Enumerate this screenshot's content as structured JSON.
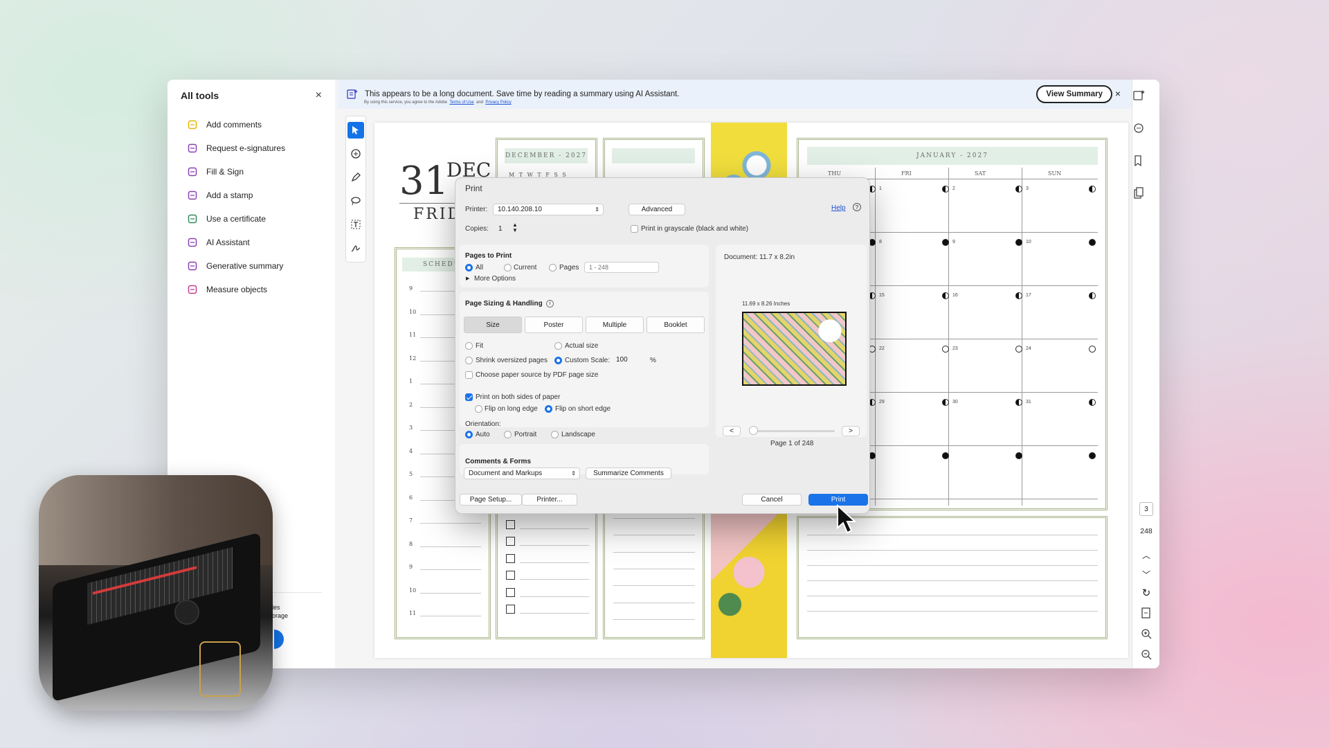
{
  "tools_panel": {
    "title": "All tools",
    "close": "×",
    "items": [
      {
        "label": "Add comments",
        "icon": "comment-icon",
        "color": "#e8b400"
      },
      {
        "label": "Request e-signatures",
        "icon": "esign-icon",
        "color": "#8a3fb0"
      },
      {
        "label": "Fill & Sign",
        "icon": "pen-icon",
        "color": "#8a3fb0"
      },
      {
        "label": "Add a stamp",
        "icon": "stamp-icon",
        "color": "#8a3fb0"
      },
      {
        "label": "Use a certificate",
        "icon": "certificate-icon",
        "color": "#2e8b57"
      },
      {
        "label": "AI Assistant",
        "icon": "ai-assistant-icon",
        "color": "#8a3fb0"
      },
      {
        "label": "Generative summary",
        "icon": "summary-icon",
        "color": "#8a3fb0"
      },
      {
        "label": "Measure objects",
        "icon": "ruler-icon",
        "color": "#c03a8a"
      }
    ],
    "footer_fragment": [
      "les",
      "orage"
    ]
  },
  "banner": {
    "text": "This appears to be a long document. Save time by reading a summary using AI Assistant.",
    "sub_prefix": "By using this service, you agree to the Adobe",
    "terms": "Terms of Use",
    "and": "and",
    "privacy": "Privacy Policy",
    "view_summary": "View Summary",
    "close": "×"
  },
  "page_nav": {
    "current": "3",
    "total": "248"
  },
  "document": {
    "big_day": "31",
    "month_short": "DEC",
    "weekday": "FRID",
    "schedule_label": "SCHEDU",
    "december_label": "DECEMBER - 2027",
    "dec_weekdays": "M  T  W  T  F  S  S",
    "january_label": "JANUARY - 2027",
    "jan_headers": [
      "THU",
      "FRI",
      "SAT",
      "SUN"
    ],
    "jan_days": [
      [
        "1",
        "2",
        "3"
      ],
      [
        "8",
        "9",
        "10"
      ],
      [
        "15",
        "16",
        "17"
      ],
      [
        "22",
        "23",
        "24"
      ],
      [
        "29",
        "30",
        "31"
      ],
      [
        "",
        "",
        ""
      ]
    ],
    "hours_top": [
      "9",
      "10",
      "11",
      "12",
      "1",
      "2",
      "3",
      "4",
      "5",
      "6",
      "7",
      "8",
      "9",
      "10",
      "11"
    ]
  },
  "print_dialog": {
    "title": "Print",
    "printer_label": "Printer:",
    "printer_value": "10.140.208.10",
    "advanced": "Advanced",
    "help": "Help",
    "copies_label": "Copies:",
    "copies_value": "1",
    "grayscale": "Print in grayscale (black and white)",
    "pages_title": "Pages to Print",
    "all": "All",
    "current": "Current",
    "pages": "Pages",
    "pages_placeholder": "1 - 248",
    "more_options": "More Options",
    "sizing_title": "Page Sizing & Handling",
    "tabs": [
      "Size",
      "Poster",
      "Multiple",
      "Booklet"
    ],
    "fit": "Fit",
    "actual_size": "Actual size",
    "shrink": "Shrink oversized pages",
    "custom_scale": "Custom Scale:",
    "scale_value": "100",
    "percent": "%",
    "paper_source": "Choose paper source by PDF page size",
    "both_sides": "Print on both sides of paper",
    "flip_long": "Flip on long edge",
    "flip_short": "Flip on short edge",
    "orientation_label": "Orientation:",
    "auto": "Auto",
    "portrait": "Portrait",
    "landscape": "Landscape",
    "comments_title": "Comments & Forms",
    "comments_value": "Document and Markups",
    "summarize": "Summarize Comments",
    "page_setup": "Page Setup...",
    "printer_btn": "Printer...",
    "cancel": "Cancel",
    "print": "Print",
    "doc_size": "Document: 11.7 x 8.2in",
    "preview_size": "11.69 x 8.26 Inches",
    "prev": "<",
    "next": ">",
    "page_of": "Page 1 of 248"
  },
  "colors": {
    "accent": "#1a73e8",
    "panel_border": "#a8b48a",
    "band": "#e2efe6"
  }
}
